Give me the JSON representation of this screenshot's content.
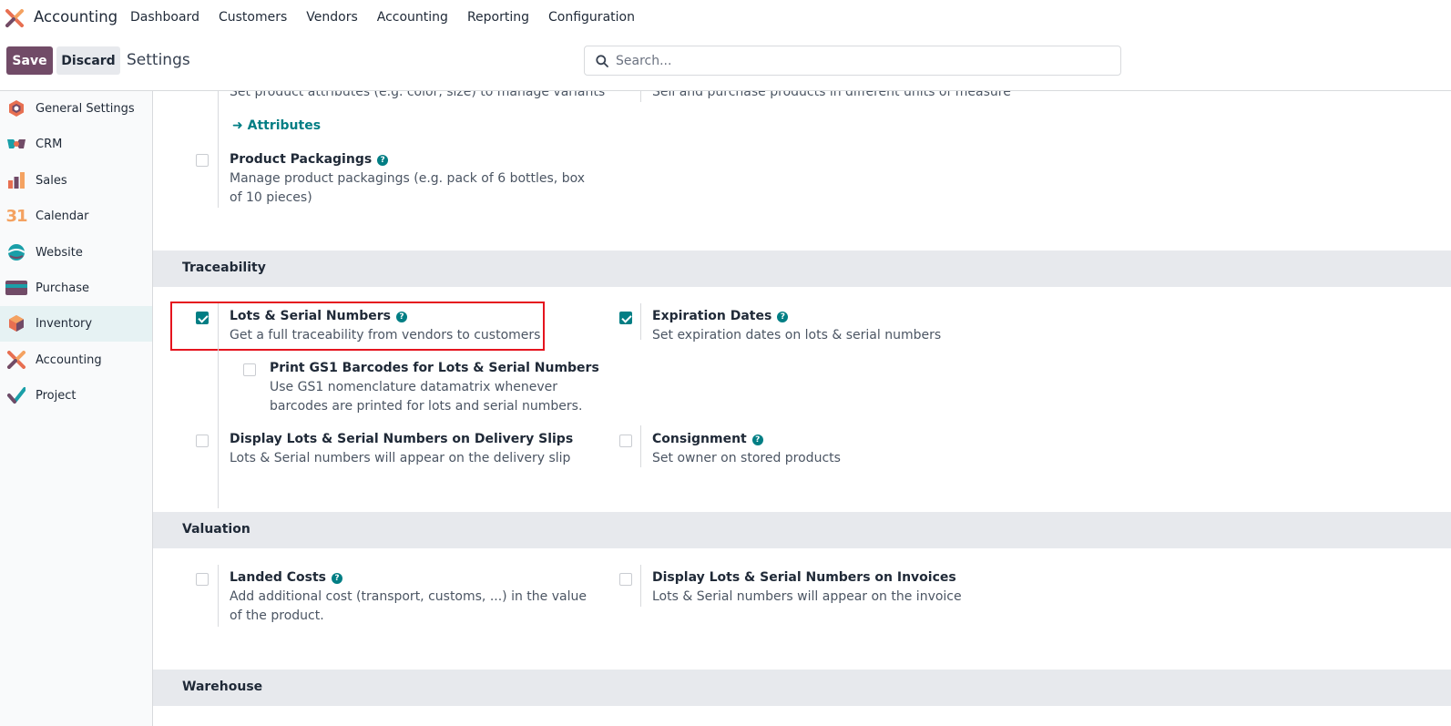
{
  "app": {
    "title": "Accounting",
    "logo_icon": "accounting-logo-icon"
  },
  "nav": {
    "menu": [
      "Dashboard",
      "Customers",
      "Vendors",
      "Accounting",
      "Reporting",
      "Configuration"
    ]
  },
  "control": {
    "save_label": "Save",
    "discard_label": "Discard",
    "breadcrumb": "Settings",
    "search_placeholder": "Search..."
  },
  "sidebar": {
    "items": [
      {
        "label": "General Settings",
        "icon": "general-settings-icon"
      },
      {
        "label": "CRM",
        "icon": "crm-icon"
      },
      {
        "label": "Sales",
        "icon": "sales-icon"
      },
      {
        "label": "Calendar",
        "icon": "calendar-icon",
        "icon_text": "31"
      },
      {
        "label": "Website",
        "icon": "website-icon"
      },
      {
        "label": "Purchase",
        "icon": "purchase-icon"
      },
      {
        "label": "Inventory",
        "icon": "inventory-icon",
        "active": true
      },
      {
        "label": "Accounting",
        "icon": "accounting-icon"
      },
      {
        "label": "Project",
        "icon": "project-icon"
      }
    ]
  },
  "content": {
    "variants_desc": "Set product attributes (e.g. color, size) to manage variants",
    "uom_desc": "Sell and purchase products in different units of measure",
    "attributes_link": "Attributes",
    "packagings": {
      "title": "Product Packagings",
      "desc": "Manage product packagings (e.g. pack of 6 bottles, box of 10 pieces)",
      "checked": false
    },
    "traceability": {
      "heading": "Traceability",
      "lots": {
        "title": "Lots & Serial Numbers",
        "desc": "Get a full traceability from vendors to customers",
        "checked": true
      },
      "expiration": {
        "title": "Expiration Dates",
        "desc": "Set expiration dates on lots & serial numbers",
        "checked": true
      },
      "gs1": {
        "title": "Print GS1 Barcodes for Lots & Serial Numbers",
        "desc": "Use GS1 nomenclature datamatrix whenever barcodes are printed for lots and serial numbers.",
        "checked": false
      },
      "delivery": {
        "title": "Display Lots & Serial Numbers on Delivery Slips",
        "desc": "Lots & Serial numbers will appear on the delivery slip",
        "checked": false
      },
      "consignment": {
        "title": "Consignment",
        "desc": "Set owner on stored products",
        "checked": false
      }
    },
    "valuation": {
      "heading": "Valuation",
      "landed": {
        "title": "Landed Costs",
        "desc": "Add additional cost (transport, customs, ...) in the value of the product.",
        "checked": false
      },
      "invoices": {
        "title": "Display Lots & Serial Numbers on Invoices",
        "desc": "Lots & Serial numbers will appear on the invoice",
        "checked": false
      }
    },
    "warehouse": {
      "heading": "Warehouse"
    }
  },
  "colors": {
    "brand": "#714B67",
    "accent": "#017e84",
    "highlight": "#e5141e"
  }
}
